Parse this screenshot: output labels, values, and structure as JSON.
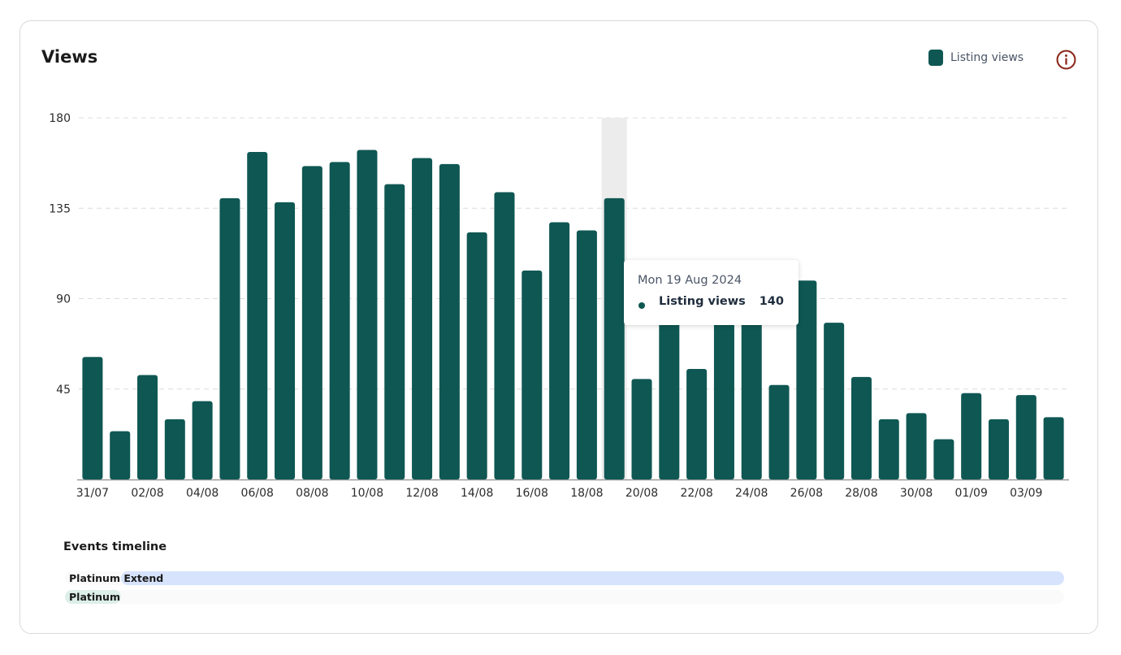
{
  "header": {
    "title": "Views",
    "info_icon": "info-circle-icon"
  },
  "legend": {
    "label": "Listing views",
    "color": "#0f5753"
  },
  "chart_data": {
    "type": "bar",
    "title": "Views",
    "xlabel": "",
    "ylabel": "",
    "ylim": [
      0,
      180
    ],
    "yticks": [
      45,
      90,
      135,
      180
    ],
    "grid": true,
    "legend_position": "top-right",
    "categories": [
      "31/07",
      "01/08",
      "02/08",
      "03/08",
      "04/08",
      "05/08",
      "06/08",
      "07/08",
      "08/08",
      "09/08",
      "10/08",
      "11/08",
      "12/08",
      "13/08",
      "14/08",
      "15/08",
      "16/08",
      "17/08",
      "18/08",
      "19/08",
      "20/08",
      "21/08",
      "22/08",
      "23/08",
      "24/08",
      "25/08",
      "26/08",
      "27/08",
      "28/08",
      "29/08",
      "30/08",
      "31/08",
      "01/09",
      "02/09",
      "03/09",
      "04/09"
    ],
    "xtick_labels": [
      "31/07",
      "02/08",
      "04/08",
      "06/08",
      "08/08",
      "10/08",
      "12/08",
      "14/08",
      "16/08",
      "18/08",
      "20/08",
      "22/08",
      "24/08",
      "26/08",
      "28/08",
      "30/08",
      "01/09",
      "03/09"
    ],
    "series": [
      {
        "name": "Listing views",
        "color": "#0f5753",
        "values": [
          61,
          24,
          52,
          30,
          39,
          140,
          163,
          138,
          156,
          158,
          164,
          147,
          160,
          157,
          123,
          143,
          104,
          128,
          124,
          140,
          50,
          85,
          55,
          80,
          78,
          47,
          99,
          78,
          51,
          30,
          33,
          20,
          43,
          30,
          42,
          31
        ]
      }
    ],
    "highlight_index": 19,
    "tooltip": {
      "date": "Mon 19 Aug 2024",
      "series": "Listing views",
      "value": "140"
    }
  },
  "events": {
    "title": "Events timeline",
    "items": [
      {
        "label": "Platinum Extend",
        "color": "#d7e3fd",
        "start": 0.056,
        "end": 1.0
      },
      {
        "label": "Platinum",
        "color": "#dcefe8",
        "start": 0.0,
        "end": 0.056
      }
    ]
  }
}
